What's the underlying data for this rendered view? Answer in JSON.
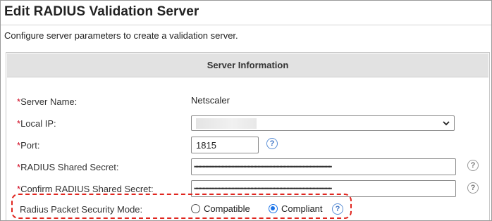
{
  "page": {
    "title": "Edit RADIUS Validation Server",
    "subtitle": "Configure server parameters to create a validation server."
  },
  "panel": {
    "header": "Server Information"
  },
  "form": {
    "required_mark": "*",
    "server_name": {
      "label": "Server Name:",
      "value": "Netscaler"
    },
    "local_ip": {
      "label": "Local IP:",
      "value": ""
    },
    "port": {
      "label": "Port:",
      "value": "1815"
    },
    "shared_secret": {
      "label": "RADIUS Shared Secret:",
      "masked": "••••••••••••••••••••••••••••••••••••••••••••••••••••••••••••••••••••••••••••••••••••••••••••••••••••"
    },
    "confirm_secret": {
      "label": "Confirm RADIUS Shared Secret:",
      "masked": "••••••••••••••••••••••••••••••••••••••••••••••••••••••••••••••••••••••••••••••••••••••••••••••••••••"
    },
    "security_mode": {
      "label": "Radius Packet Security Mode:",
      "options": [
        "Compatible",
        "Compliant"
      ],
      "selected": "Compliant"
    },
    "help_glyph": "?"
  },
  "colors": {
    "accent": "#1a73e8",
    "required": "#d0021b",
    "highlight": "#e0261f",
    "panel_header_bg": "#e2e2e2"
  },
  "icons": {
    "help": "question-circle-icon",
    "dropdown": "chevron-down-icon"
  }
}
